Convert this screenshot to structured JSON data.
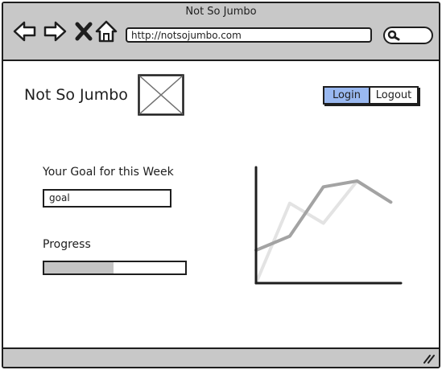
{
  "window": {
    "title": "Not So Jumbo"
  },
  "browser": {
    "url": "http://notsojumbo.com",
    "icons": [
      "back-arrow-icon",
      "forward-arrow-icon",
      "close-icon",
      "home-icon",
      "search-icon"
    ]
  },
  "header": {
    "site_title": "Not So Jumbo",
    "logo": "image-placeholder-icon",
    "login_label": "Login",
    "logout_label": "Logout",
    "login_active": true
  },
  "goal": {
    "label": "Your Goal for this Week",
    "value": "goal"
  },
  "progress": {
    "label": "Progress",
    "fraction": 0.49
  },
  "colors": {
    "chrome": "#c8c8c8",
    "ink": "#1e1e1e",
    "accent": "#99b8f0",
    "progress_fill": "#c4c4c4",
    "series_light": "#e3e3e3",
    "series_dark": "#a3a3a3"
  },
  "chart_data": {
    "type": "line",
    "title": "",
    "xlabel": "",
    "ylabel": "",
    "x": [
      0,
      1,
      2,
      3,
      4
    ],
    "xlim": [
      0,
      4.3
    ],
    "ylim": [
      0,
      1
    ],
    "grid": false,
    "series": [
      {
        "values": [
          0.0,
          0.68,
          0.51,
          0.87,
          0.69
        ],
        "color": "#e3e3e3"
      },
      {
        "values": [
          0.28,
          0.4,
          0.82,
          0.87,
          0.69
        ],
        "color": "#a3a3a3"
      }
    ]
  }
}
